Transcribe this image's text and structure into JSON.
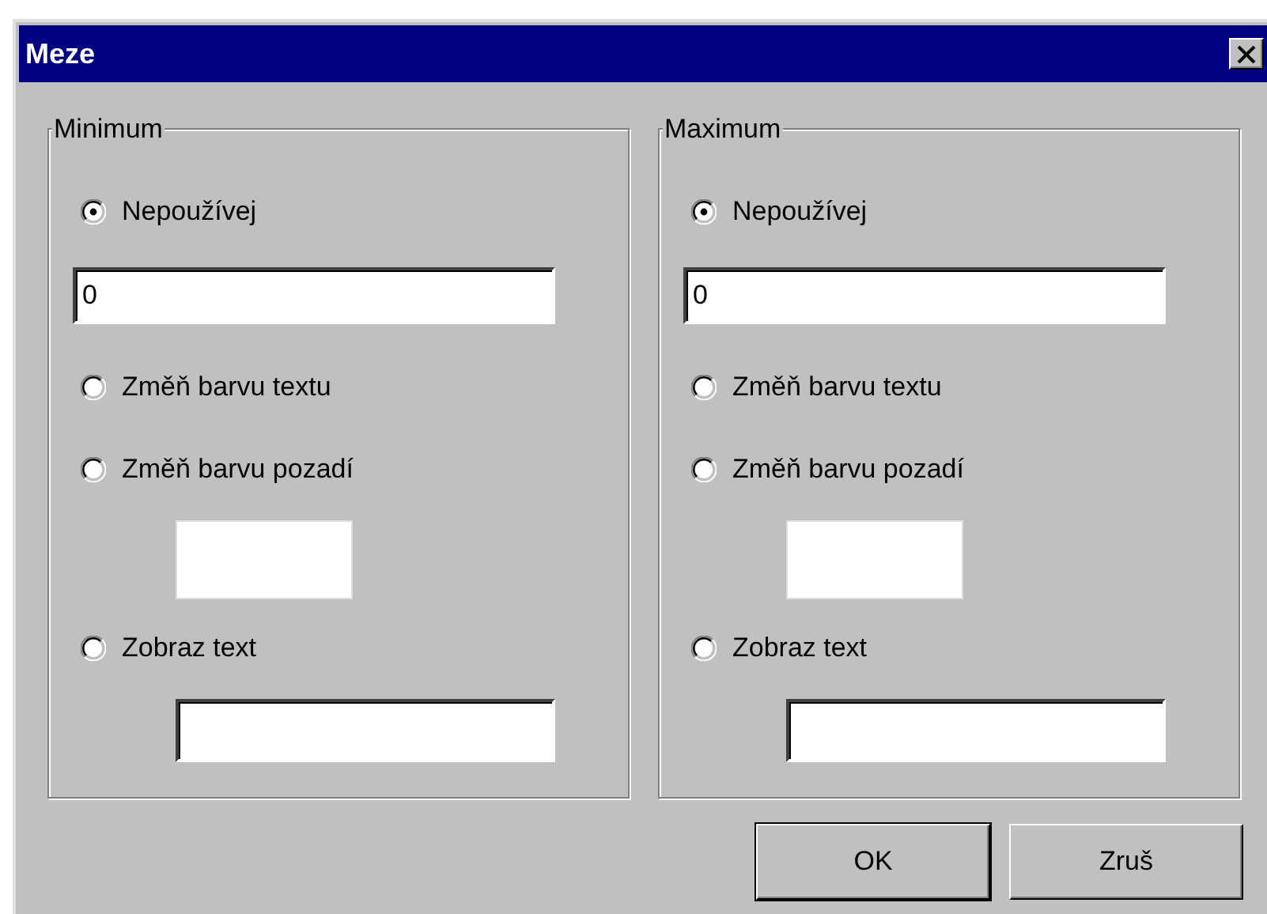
{
  "window": {
    "title": "Meze"
  },
  "groups": [
    {
      "title": "Minimum",
      "items": [
        {
          "kind": "radio",
          "label": "Nepoužívej",
          "selected": true
        },
        {
          "kind": "input",
          "value": "0"
        },
        {
          "kind": "radio",
          "label": "Změň barvu textu",
          "selected": false
        },
        {
          "kind": "radio",
          "label": "Změň barvu pozadí",
          "selected": false
        },
        {
          "kind": "swatch",
          "color": "#ffffff"
        },
        {
          "kind": "radio",
          "label": "Zobraz text",
          "selected": false
        },
        {
          "kind": "textbox"
        }
      ]
    },
    {
      "title": "Maximum",
      "items": [
        {
          "kind": "radio",
          "label": "Nepoužívej",
          "selected": true
        },
        {
          "kind": "input",
          "value": "0"
        },
        {
          "kind": "radio",
          "label": "Změň barvu textu",
          "selected": false
        },
        {
          "kind": "radio",
          "label": "Změň barvu pozadí",
          "selected": false
        },
        {
          "kind": "swatch",
          "color": "#ffffff"
        },
        {
          "kind": "radio",
          "label": "Zobraz text",
          "selected": false
        },
        {
          "kind": "textbox"
        }
      ]
    }
  ],
  "buttons": [
    {
      "label": "OK",
      "default": true
    },
    {
      "label": "Zruš",
      "default": false
    }
  ]
}
